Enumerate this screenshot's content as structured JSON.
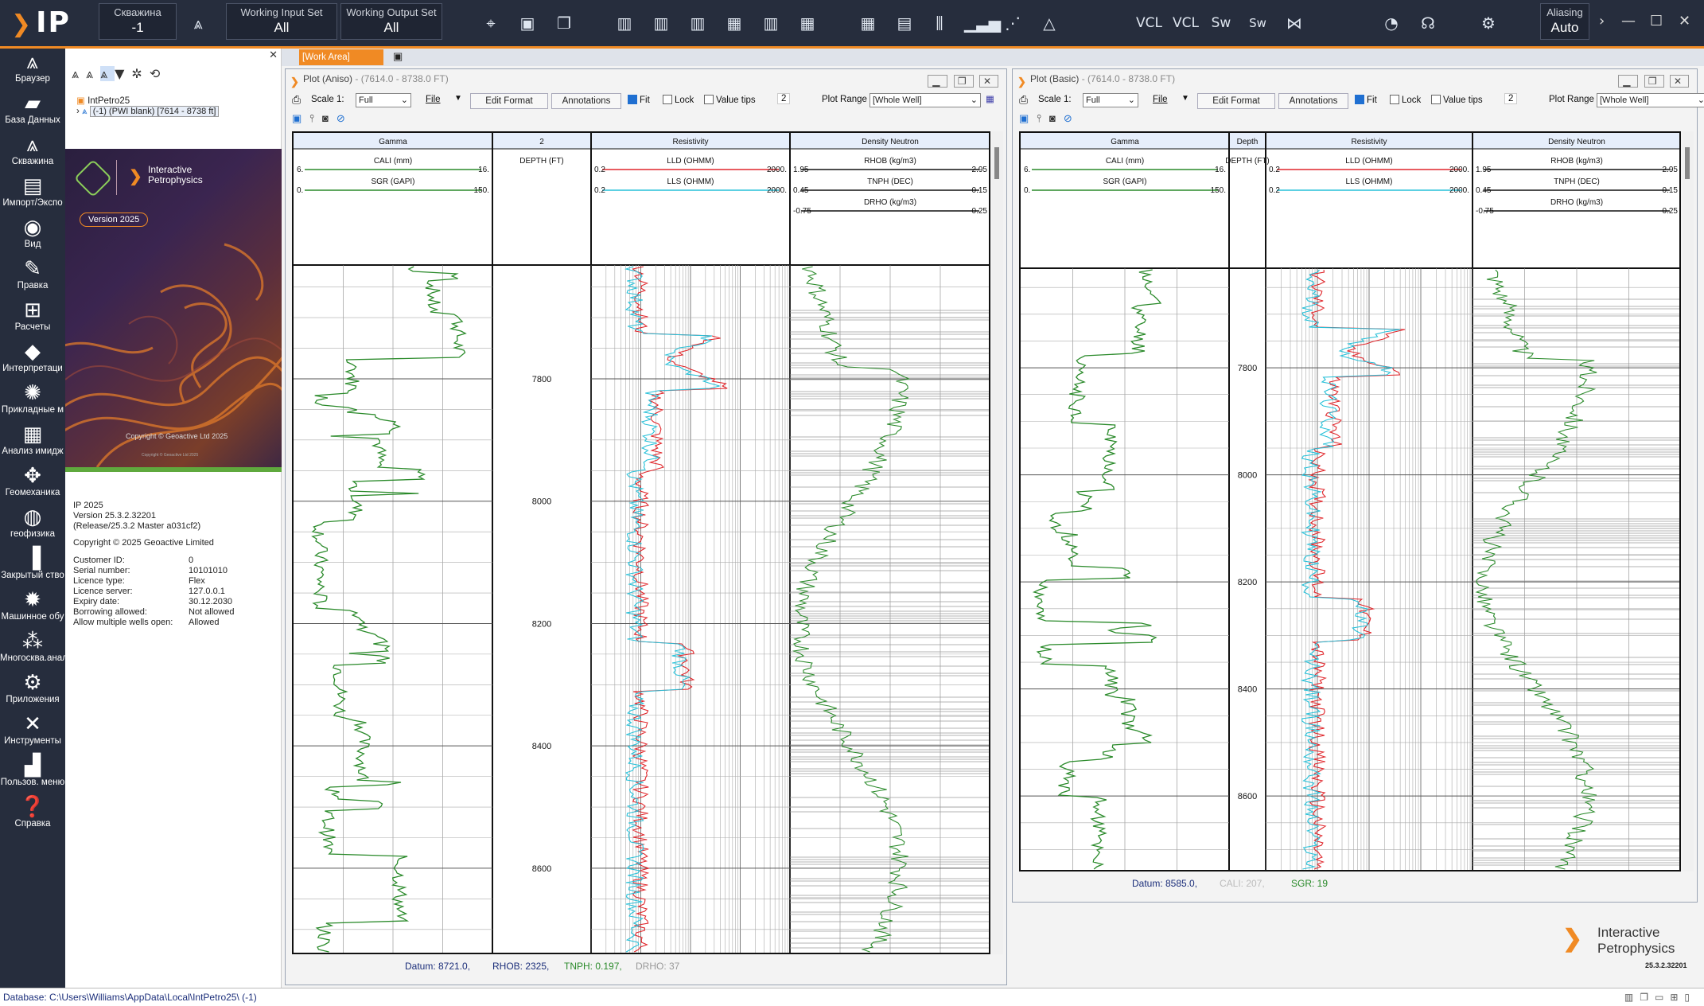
{
  "app": {
    "logo": "IP",
    "well_select": {
      "caption": "Скважина",
      "value": "-1"
    },
    "input_set": {
      "caption": "Working Input Set",
      "value": "All"
    },
    "output_set": {
      "caption": "Working Output Set",
      "value": "All"
    },
    "aliasing": {
      "caption": "Aliasing",
      "value": "Auto"
    },
    "toolbar_texts": {
      "vcl1": "VCL",
      "vcl2": "VCL",
      "sw": "Sw",
      "swsw": "Sw"
    }
  },
  "sidebar": {
    "items": [
      {
        "label": "Браузер",
        "icon": "tree-icon"
      },
      {
        "label": "База Данных",
        "icon": "folder-icon"
      },
      {
        "label": "Скважина",
        "icon": "well-icon"
      },
      {
        "label": "Импорт/Экспо",
        "icon": "import-icon"
      },
      {
        "label": "Вид",
        "icon": "eye-icon"
      },
      {
        "label": "Правка",
        "icon": "edit-icon"
      },
      {
        "label": "Расчеты",
        "icon": "calc-icon"
      },
      {
        "label": "Интерпретаци",
        "icon": "drop-icon"
      },
      {
        "label": "Прикладные м",
        "icon": "apps-icon"
      },
      {
        "label": "Анализ имидж",
        "icon": "image-icon"
      },
      {
        "label": "Геомеханика",
        "icon": "geomech-icon"
      },
      {
        "label": "геофизика",
        "icon": "geophys-icon"
      },
      {
        "label": "Закрытый ство",
        "icon": "casing-icon"
      },
      {
        "label": "Машинное обу",
        "icon": "brain-icon"
      },
      {
        "label": "Многосква.анал",
        "icon": "multiwell-icon"
      },
      {
        "label": "Приложения",
        "icon": "gear-icon"
      },
      {
        "label": "Инструменты",
        "icon": "tools-icon"
      },
      {
        "label": "Пользов. меню",
        "icon": "usermenu-icon"
      },
      {
        "label": "Справка",
        "icon": "help-icon"
      }
    ]
  },
  "browser": {
    "tree_root": "IntPetro25",
    "tree_child": "(-1) (PWI blank) [7614 - 8738 ft]",
    "splash": {
      "brand_line1": "Interactive",
      "brand_line2": "Petrophysics",
      "version_badge": "Version 2025",
      "copyright": "Copyright © Geoactive Ltd 2025",
      "small_copyright": "Copyright © Geoactive Ltd 2025"
    },
    "about": {
      "product": "IP 2025",
      "version": "Version 25.3.2.32201",
      "release": "(Release/25.3.2 Master a031cf2)",
      "copyright": "Copyright © 2025 Geoactive Limited",
      "fields": [
        {
          "k": "Customer ID:",
          "v": "0"
        },
        {
          "k": "Serial number:",
          "v": "10101010"
        },
        {
          "k": "Licence type:",
          "v": "Flex"
        },
        {
          "k": "Licence server:",
          "v": "127.0.0.1"
        },
        {
          "k": "Expiry date:",
          "v": "30.12.2030"
        },
        {
          "k": "Borrowing allowed:",
          "v": "Not allowed"
        },
        {
          "k": "Allow multiple wells open:",
          "v": "Allowed"
        }
      ]
    }
  },
  "work_area_tab": "[Work Area]",
  "plots": [
    {
      "title": "Plot (Aniso)",
      "range_text": " -  (7614.0 - 8738.0 FT)",
      "scale_label": "Scale 1:",
      "scale_value": "Full",
      "file_label": "File",
      "edit_format": "Edit Format",
      "annotations": "Annotations",
      "fit": "Fit",
      "lock": "Lock",
      "value_tips": "Value tips",
      "num": "2",
      "plot_range_label": "Plot Range",
      "plot_range_value": "[Whole Well]",
      "tracks": {
        "gamma": "Gamma",
        "depth": "2",
        "resistivity": "Resistivity",
        "density": "Density Neutron"
      },
      "curves": {
        "cali": {
          "name": "CALI (mm)",
          "min": "6.",
          "max": "16."
        },
        "sgr": {
          "name": "SGR (GAPI)",
          "min": "0.",
          "max": "150."
        },
        "depth": {
          "name": "DEPTH (FT)"
        },
        "lld": {
          "name": "LLD (OHMM)",
          "min": "0.2",
          "max": "2000."
        },
        "lls": {
          "name": "LLS (OHMM)",
          "min": "0.2",
          "max": "2000."
        },
        "rhob": {
          "name": "RHOB (kg/m3)",
          "min": "1.95",
          "max": "2.95"
        },
        "tnph": {
          "name": "TNPH (DEC)",
          "min": "0.45",
          "max": "-0.15"
        },
        "drho": {
          "name": "DRHO (kg/m3)",
          "min": "-0.75",
          "max": "0.25"
        }
      },
      "depth_ticks": [
        "7800",
        "8000",
        "8200",
        "8400",
        "8600"
      ],
      "status": {
        "datum": "Datum: 8721.0,",
        "rhob": "RHOB: 2325,",
        "tnph": "TNPH: 0.197,",
        "drho": "DRHO: 37"
      }
    },
    {
      "title": "Plot (Basic)",
      "range_text": " -  (7614.0 - 8738.0 FT)",
      "scale_label": "Scale 1:",
      "scale_value": "Full",
      "file_label": "File",
      "edit_format": "Edit Format",
      "annotations": "Annotations",
      "fit": "Fit",
      "lock": "Lock",
      "value_tips": "Value tips",
      "num": "2",
      "plot_range_label": "Plot Range",
      "plot_range_value": "[Whole Well]",
      "tracks": {
        "gamma": "Gamma",
        "depth": "Depth",
        "resistivity": "Resistivity",
        "density": "Density Neutron"
      },
      "curves": {
        "cali": {
          "name": "CALI (mm)",
          "min": "6.",
          "max": "16."
        },
        "sgr": {
          "name": "SGR (GAPI)",
          "min": "0.",
          "max": "150."
        },
        "depth": {
          "name": "DEPTH (FT)"
        },
        "lld": {
          "name": "LLD (OHMM)",
          "min": "0.2",
          "max": "2000."
        },
        "lls": {
          "name": "LLS (OHMM)",
          "min": "0.2",
          "max": "2000."
        },
        "rhob": {
          "name": "RHOB (kg/m3)",
          "min": "1.95",
          "max": "2.95"
        },
        "tnph": {
          "name": "TNPH (DEC)",
          "min": "0.45",
          "max": "-0.15"
        },
        "drho": {
          "name": "DRHO (kg/m3)",
          "min": "-0.75",
          "max": "0.25"
        }
      },
      "depth_ticks": [
        "7800",
        "8000",
        "8200",
        "8400",
        "8600"
      ],
      "status": {
        "datum": "Datum: 8585.0,",
        "cali": "CALI: 207,",
        "sgr": "SGR: 19"
      }
    }
  ],
  "ip_logo": {
    "line1": "Interactive",
    "line2": "Petrophysics",
    "version": "25.3.2.32201"
  },
  "statusbar": {
    "database": "Database: C:\\Users\\Williams\\AppData\\Local\\IntPetro25\\  (-1)"
  },
  "colors": {
    "accent": "#f08a24",
    "dark": "#262d3d",
    "gamma": "#2a8a2a",
    "lld": "#e0262b",
    "lls": "#27c0d8"
  }
}
